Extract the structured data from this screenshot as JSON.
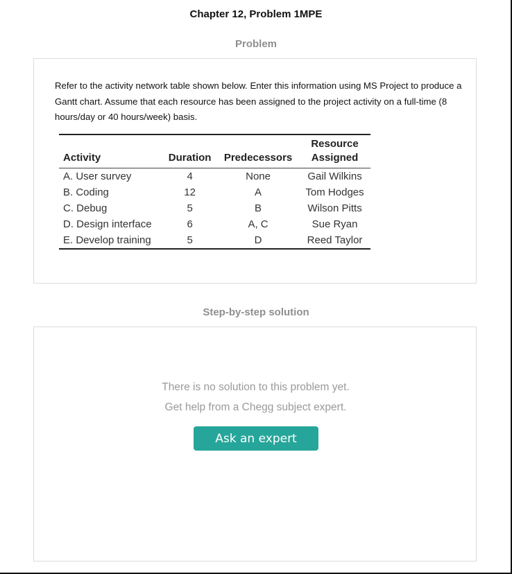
{
  "header": {
    "title": "Chapter 12, Problem 1MPE"
  },
  "problem": {
    "section_title": "Problem",
    "text": "Refer to the activity network table shown below. Enter this information using MS Project to produce a Gantt chart. Assume that each resource has been assigned to the project activity on a full-time (8 hours/day or 40 hours/week) basis.",
    "table": {
      "headers": {
        "activity": "Activity",
        "duration": "Duration",
        "predecessors": "Predecessors",
        "resource_line1": "Resource",
        "resource_line2": "Assigned"
      },
      "rows": [
        {
          "activity": "A. User survey",
          "duration": "4",
          "predecessors": "None",
          "resource": "Gail Wilkins"
        },
        {
          "activity": "B. Coding",
          "duration": "12",
          "predecessors": "A",
          "resource": "Tom Hodges"
        },
        {
          "activity": "C. Debug",
          "duration": "5",
          "predecessors": "B",
          "resource": "Wilson Pitts"
        },
        {
          "activity": "D. Design interface",
          "duration": "6",
          "predecessors": "A, C",
          "resource": "Sue Ryan"
        },
        {
          "activity": "E. Develop training",
          "duration": "5",
          "predecessors": "D",
          "resource": "Reed Taylor"
        }
      ]
    }
  },
  "solution": {
    "section_title": "Step-by-step solution",
    "empty_line1": "There is no solution to this problem yet.",
    "empty_line2": "Get help from a Chegg subject expert.",
    "ask_button": "Ask an expert",
    "accent_color": "#26a69a"
  }
}
